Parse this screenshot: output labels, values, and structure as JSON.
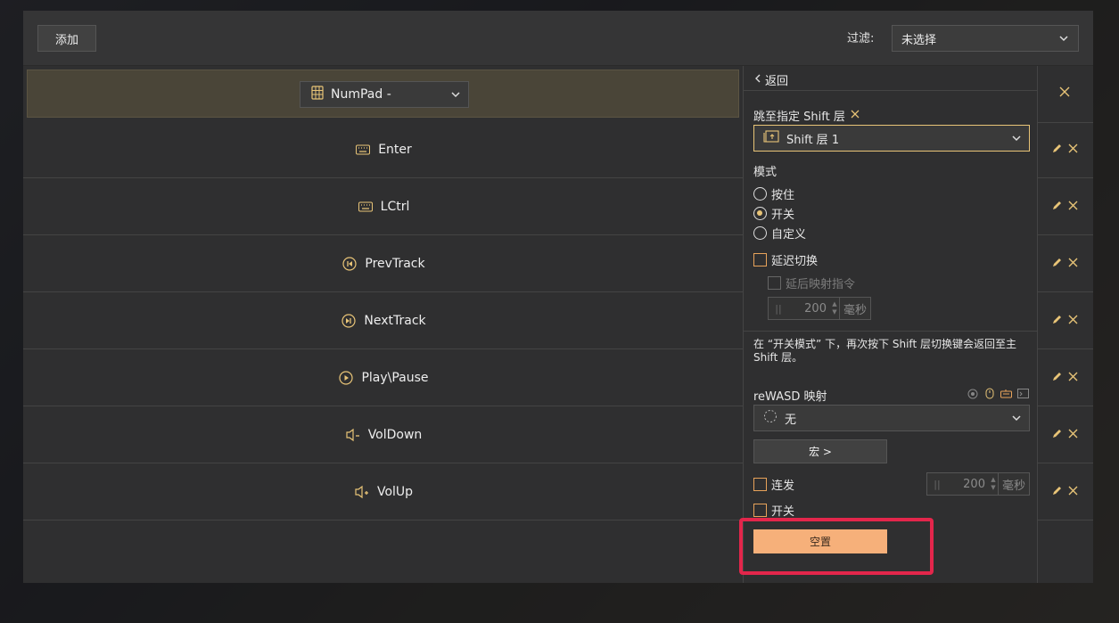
{
  "colors": {
    "accent": "#e8c477",
    "clear_button": "#f6b07a",
    "highlight": "#e3264b"
  },
  "toolbar": {
    "add_label": "添加",
    "filter_label": "过滤:",
    "filter_value": "未选择"
  },
  "group": {
    "selected": "NumPad -",
    "icon": "numpad-icon"
  },
  "rows": [
    {
      "label": "Enter",
      "icon": "keyboard-icon"
    },
    {
      "label": "LCtrl",
      "icon": "keyboard-icon"
    },
    {
      "label": "PrevTrack",
      "icon": "prev-track-icon"
    },
    {
      "label": "NextTrack",
      "icon": "next-track-icon"
    },
    {
      "label": "Play\\Pause",
      "icon": "play-pause-icon"
    },
    {
      "label": "VolDown",
      "icon": "volume-down-icon"
    },
    {
      "label": "VolUp",
      "icon": "volume-up-icon"
    }
  ],
  "panel": {
    "back_label": "返回",
    "jump_label": "跳至指定 Shift 层",
    "shift_selected": "Shift 层 1",
    "mode_label": "模式",
    "modes": [
      "按住",
      "开关",
      "自定义"
    ],
    "mode_selected": "开关",
    "delay_switch": "延迟切换",
    "delay_mapping": "延后映射指令",
    "delay_value": "200",
    "unit_ms": "毫秒",
    "note": "在 “开关模式” 下，再次按下 Shift 层切换键会返回至主 Shift 层。",
    "rewasd_label": "reWASD 映射",
    "mapping_value": "无",
    "macro_button": "宏 >",
    "turbo_label": "连发",
    "turbo_value": "200",
    "toggle_label": "开关",
    "clear_button": "空置"
  }
}
